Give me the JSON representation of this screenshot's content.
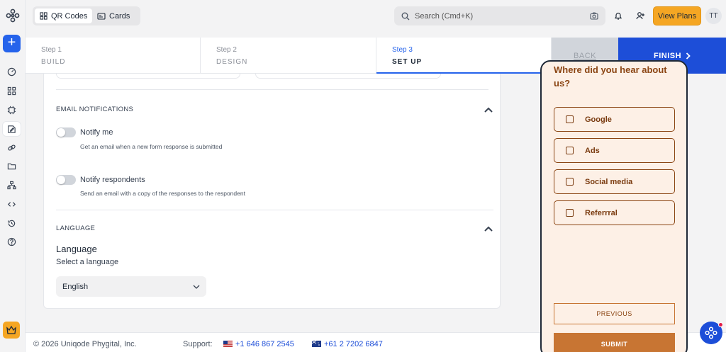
{
  "header": {
    "tabs": [
      {
        "label": "QR Codes",
        "active": true
      },
      {
        "label": "Cards",
        "active": false
      }
    ],
    "search_placeholder": "Search (Cmd+K)",
    "view_plans_label": "View Plans",
    "avatar_initials": "TT"
  },
  "sidebar": {
    "icons": [
      "dashboard-icon",
      "qr-grid-icon",
      "chip-icon",
      "form-icon",
      "link-icon",
      "folder-icon",
      "sitemap-icon",
      "code-icon",
      "history-icon",
      "help-icon"
    ],
    "active_index": 3
  },
  "stepper": {
    "steps": [
      {
        "number": "Step 1",
        "title": "BUILD"
      },
      {
        "number": "Step 2",
        "title": "DESIGN"
      },
      {
        "number": "Step 3",
        "title": "SET UP"
      }
    ],
    "active_step": 2,
    "back_label": "BACK",
    "finish_label": "FINISH"
  },
  "email_notifications": {
    "title": "EMAIL NOTIFICATIONS",
    "toggles": [
      {
        "label": "Notify me",
        "description": "Get an email when a new form response is submitted",
        "on": false
      },
      {
        "label": "Notify respondents",
        "description": "Send an email with a copy of the responses to the respondent",
        "on": false
      }
    ]
  },
  "language": {
    "section_title": "LANGUAGE",
    "heading": "Language",
    "subheading": "Select a language",
    "selected": "English"
  },
  "footer": {
    "copyright": "© 2026 Uniqode Phygital, Inc.",
    "support_label": "Support:",
    "phone_us": "+1 646 867 2545",
    "phone_au": "+61 2 7202 6847"
  },
  "preview": {
    "question": "Where did you hear about us?",
    "options": [
      "Google",
      "Ads",
      "Social media",
      "Referrral"
    ],
    "previous_label": "PREVIOUS",
    "submit_label": "SUBMIT"
  },
  "colors": {
    "accent": "#2563eb",
    "finish": "#1d4ed8",
    "plans": "#f5a623",
    "preview_bg": "#fdf0e6",
    "preview_brown": "#8b4513",
    "submit": "#c87533"
  }
}
